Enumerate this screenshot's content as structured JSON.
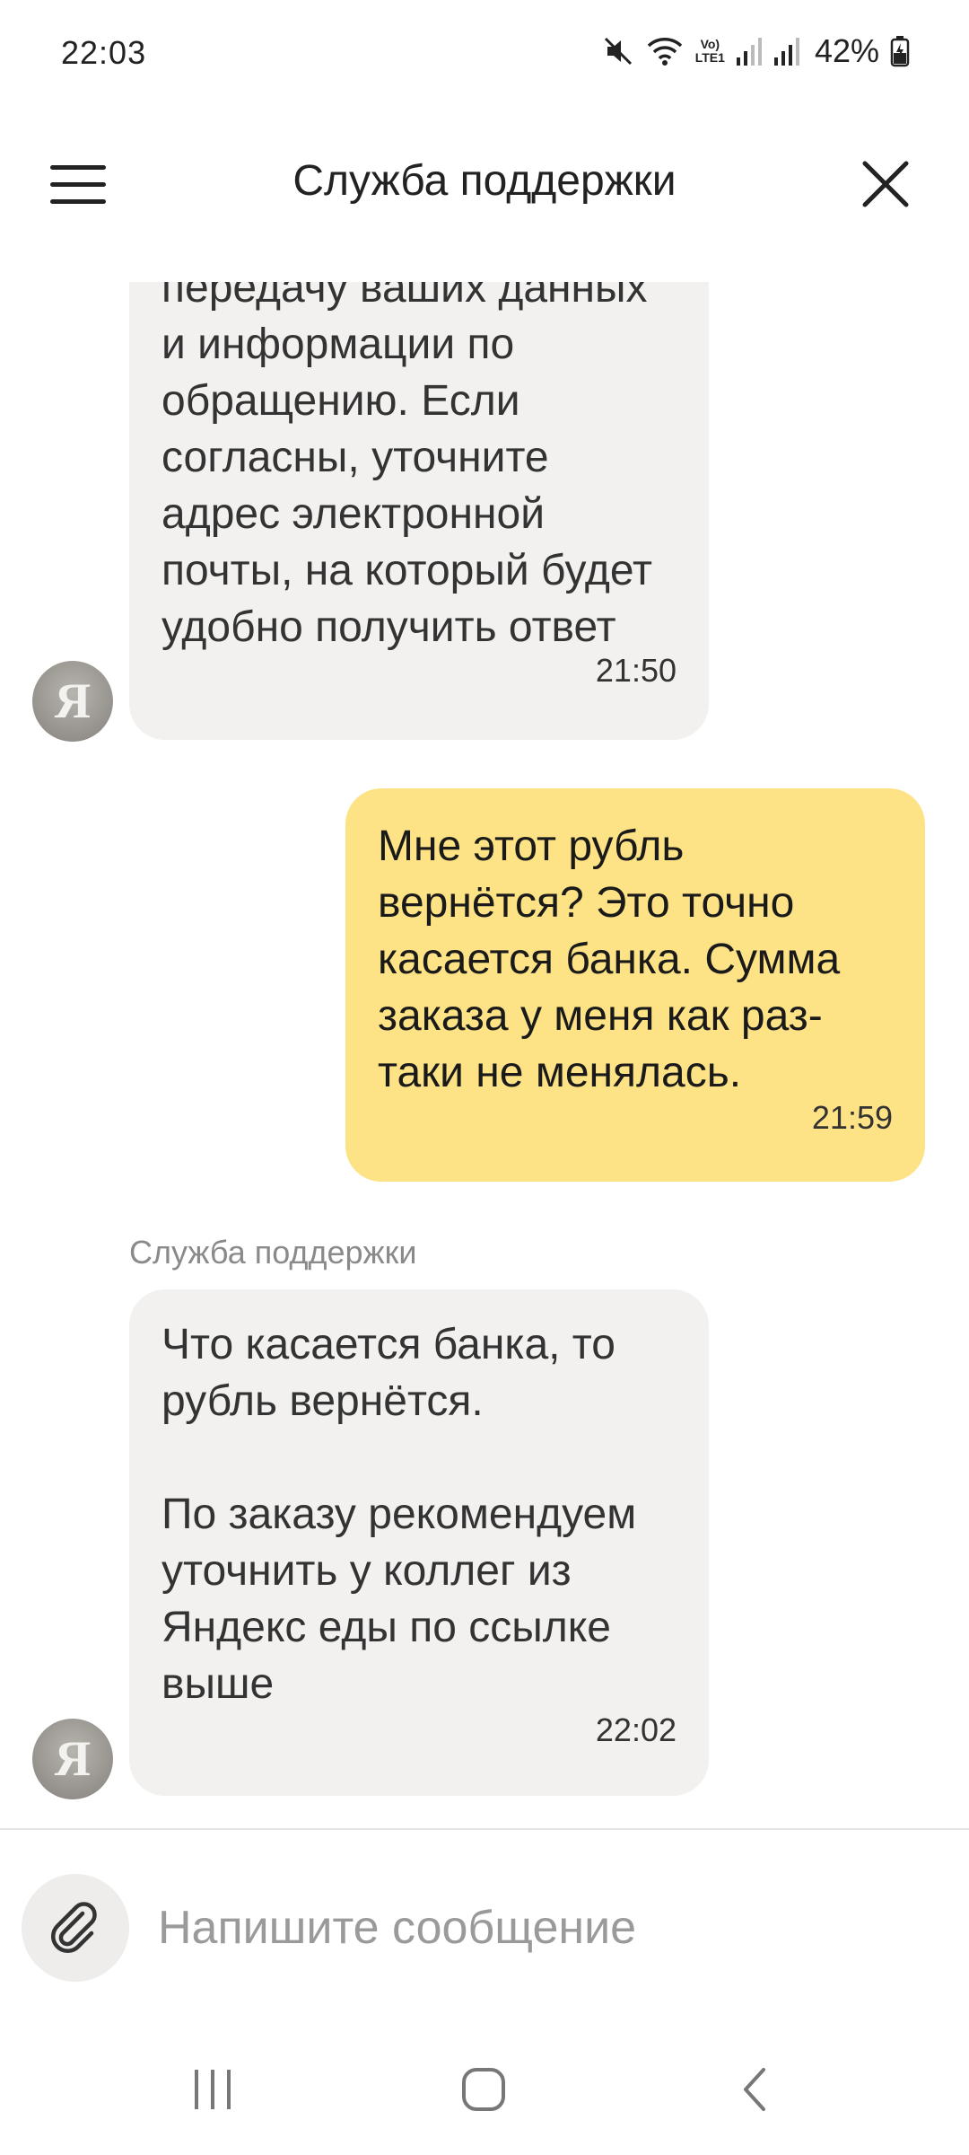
{
  "status_bar": {
    "time": "22:03",
    "network_label_top": "Vo)",
    "network_label_bottom": "LTE1",
    "battery_percent": "42%"
  },
  "header": {
    "title": "Служба поддержки",
    "menu_icon": "hamburger-menu-icon",
    "close_icon": "close-icon"
  },
  "messages": [
    {
      "direction": "incoming",
      "text": "передачу ваших данных\nи информации по\nобращению. Если\nсогласны, уточните\nадрес электронной\nпочты, на который будет\nудобно получить ответ",
      "time": "21:50",
      "avatar_letter": "Я"
    },
    {
      "direction": "outgoing",
      "text": "Мне этот рубль\nвернётся? Это точно\nкасается банка. Сумма\nзаказа у меня как раз-\nтаки не менялась.",
      "time": "21:59"
    },
    {
      "direction": "incoming",
      "sender": "Служба поддержки",
      "text": "Что касается банка, то\nрубль вернётся.\n\nПо заказу рекомендуем\nуточнить у коллег из\nЯндекс еды по ссылке\nвыше",
      "time": "22:02",
      "avatar_letter": "Я"
    }
  ],
  "composer": {
    "placeholder": "Напишите сообщение",
    "value": "",
    "attach_icon": "paperclip-icon"
  },
  "colors": {
    "incoming_bubble": "#f2f1ef",
    "outgoing_bubble": "#fde385",
    "muted_text": "#8a8a8a"
  }
}
